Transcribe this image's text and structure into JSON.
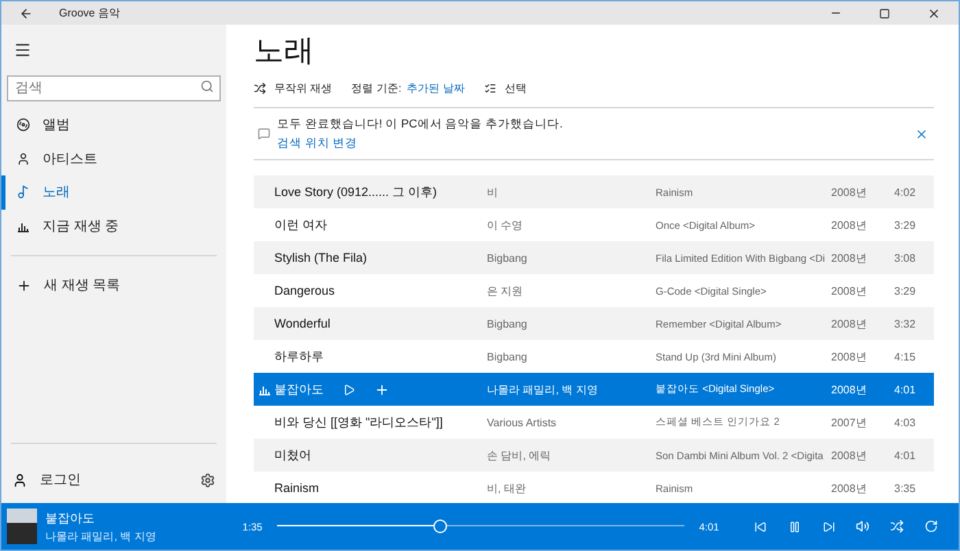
{
  "title_bar": {
    "title": "Groove 음악"
  },
  "sidebar": {
    "search": {
      "placeholder": "검색"
    },
    "nav": [
      {
        "kind": "albums",
        "label": "앨범",
        "selected": false
      },
      {
        "kind": "artists",
        "label": "아티스트",
        "selected": false
      },
      {
        "kind": "songs",
        "label": "노래",
        "selected": true
      },
      {
        "kind": "now_playing",
        "label": "지금 재생 중",
        "selected": false
      }
    ],
    "new_playlist": "새 재생 목록",
    "sign_in": "로그인"
  },
  "main": {
    "heading": "노래",
    "toolbar": {
      "shuffle": "무작위 재생",
      "sort_label": "정렬 기준:",
      "sort_value": "추가된 날짜",
      "select": "선택"
    },
    "notification": {
      "message": "모두 완료했습니다! 이 PC에서 음악을 추가했습니다.",
      "link": "검색 위치 변경"
    },
    "songs": [
      {
        "title": "Love Story (0912...... 그 이후)",
        "artist": "비",
        "album": "Rainism",
        "year": "2008년",
        "duration": "4:02",
        "selected": false
      },
      {
        "title": "이런 여자",
        "artist": "이 수영",
        "album": "Once <Digital Album>",
        "year": "2008년",
        "duration": "3:29",
        "selected": false
      },
      {
        "title": "Stylish (The Fila)",
        "artist": "Bigbang",
        "album": "Fila Limited Edition With Bigbang <Di",
        "year": "2008년",
        "duration": "3:08",
        "selected": false
      },
      {
        "title": "Dangerous",
        "artist": "은 지원",
        "album": "G-Code <Digital Single>",
        "year": "2008년",
        "duration": "3:29",
        "selected": false
      },
      {
        "title": "Wonderful",
        "artist": "Bigbang",
        "album": "Remember <Digital Album>",
        "year": "2008년",
        "duration": "3:32",
        "selected": false
      },
      {
        "title": "하루하루",
        "artist": "Bigbang",
        "album": "Stand Up (3rd Mini Album)",
        "year": "2008년",
        "duration": "4:15",
        "selected": false
      },
      {
        "title": "붙잡아도",
        "artist": "나몰라 패밀리, 백 지영",
        "album": "붙잡아도 <Digital Single>",
        "year": "2008년",
        "duration": "4:01",
        "selected": true
      },
      {
        "title": "비와 당신 [[영화 \"라디오스타\"]]",
        "artist": "Various Artists",
        "album": "스페셜 베스트 인기가요 2",
        "year": "2007년",
        "duration": "4:03",
        "selected": false
      },
      {
        "title": "미쳤어",
        "artist": "손 담비, 에릭",
        "album": "Son Dambi Mini Album Vol. 2 <Digita",
        "year": "2008년",
        "duration": "4:01",
        "selected": false
      },
      {
        "title": "Rainism",
        "artist": "비, 태완",
        "album": "Rainism",
        "year": "2008년",
        "duration": "3:35",
        "selected": false
      }
    ]
  },
  "player": {
    "title": "붙잡아도",
    "artist": "나몰라 패밀리, 백 지영",
    "elapsed": "1:35",
    "total": "4:01",
    "level": 0.4
  }
}
